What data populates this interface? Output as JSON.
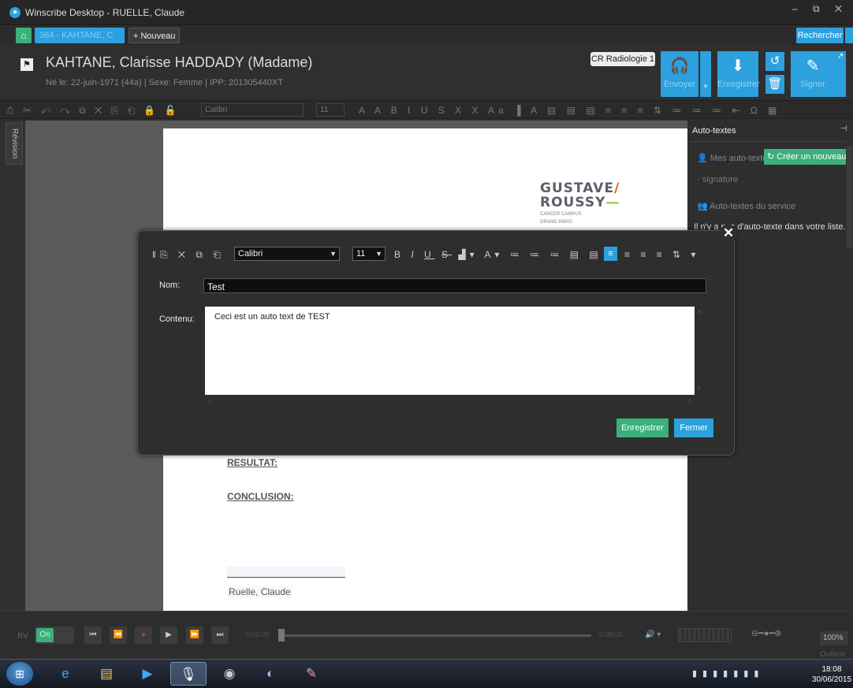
{
  "window": {
    "title": "Winscribe Desktop - RUELLE, Claude",
    "controls": "– ⧉ ✕"
  },
  "tabs": {
    "patient_tab": "364 - KAHTANE, C",
    "new_tab": "+ Nouveau",
    "search_label": "Rechercher"
  },
  "patient": {
    "name": "KAHTANE, Clarisse HADDADY (Madame)",
    "meta": "Né le: 22-juin-1971 (44a)  |  Sexe: Femme  |  IPP: 201305440XT",
    "template": "CR Radiologie 1"
  },
  "actions": {
    "send": "Envoyer",
    "save": "Enregistrer",
    "sign": "Signer"
  },
  "main_toolbar": {
    "font": "Calibri",
    "size": "11"
  },
  "sidebar": {
    "revision_tab": "Révision",
    "title": "Auto-textes",
    "my_autotexts": "Mes auto-textes",
    "create_new": "Créer un nouveau",
    "signature_item": "· signature",
    "service_autotexts": "Auto-textes du service",
    "empty_message": "Il n'y a pas d'auto-texte dans votre liste."
  },
  "document": {
    "logo_line1": "GUSTAVE",
    "logo_line2": "ROUSSY",
    "logo_sub1": "CANCER CAMPUS",
    "logo_sub2": "GRAND PARIS",
    "section_result": "RESULTAT:",
    "section_conclusion": "CONCLUSION:",
    "signer": "Ruelle, Claude"
  },
  "modal": {
    "font": "Calibri",
    "size": "11",
    "name_label": "Nom:",
    "name_value": "Test",
    "content_label": "Contenu:",
    "content_value": "Ceci est un auto text de TEST",
    "save_button": "Enregistrer",
    "close_button": "Fermer"
  },
  "player": {
    "rv_label": "RV",
    "toggle_label": "On",
    "time_start": "0:00:00",
    "time_end": "0:00:00",
    "zoom": "100%",
    "outbox": "Outbox"
  },
  "taskbar": {
    "time": "18:08",
    "date": "30/06/2015"
  },
  "colors": {
    "accent_blue": "#2da0de",
    "accent_green": "#3bb07a",
    "dark_bg": "#2f2f2f"
  }
}
